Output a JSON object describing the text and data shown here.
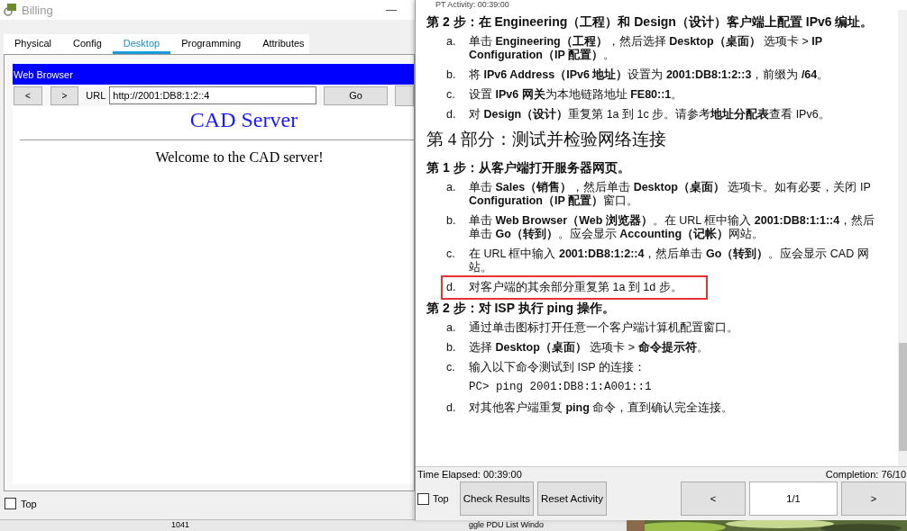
{
  "left_window": {
    "title": "Billing",
    "tabs": [
      {
        "label": "Physical",
        "selected": false
      },
      {
        "label": "Config",
        "selected": false
      },
      {
        "label": "Desktop",
        "selected": true
      },
      {
        "label": "Programming",
        "selected": false
      },
      {
        "label": "Attributes",
        "selected": false
      }
    ],
    "browser": {
      "title": "Web Browser",
      "back": "<",
      "forward": ">",
      "url_label": "URL",
      "url": "http://2001:DB8:1:2::4",
      "go": "Go",
      "page_heading": "CAD Server",
      "page_text": "Welcome to the CAD server!"
    },
    "top": {
      "label": "Top",
      "checked": false
    }
  },
  "activity_window": {
    "title": "PT Activity: 00:39:00",
    "blocks": [
      {
        "kind": "step",
        "text": "第 2 步：在 Engineering（工程）和 Design（设计）客户端上配置 IPv6 编址。"
      },
      {
        "kind": "item",
        "letter": "a.",
        "text": "单击 **Engineering（工程）**，然后选择 **Desktop（桌面）** 选项卡 > **IP Configuration（IP 配置）**。",
        "highlighted": false
      },
      {
        "kind": "item",
        "letter": "b.",
        "text": "将 **IPv6 Address（IPv6 地址）**设置为 **2001:DB8:1:2::3**，前缀为 **/64**。",
        "highlighted": false
      },
      {
        "kind": "item",
        "letter": "c.",
        "text": "设置 **IPv6 网关**为本地链路地址 **FE80::1**。",
        "highlighted": false
      },
      {
        "kind": "item",
        "letter": "d.",
        "text": "对 **Design（设计）**重复第 1a 到 1c 步。请参考**地址分配表**查看 IPv6。",
        "highlighted": false
      },
      {
        "kind": "part",
        "text": "第 4 部分：测试并检验网络连接"
      },
      {
        "kind": "step",
        "text": "第 1 步：从客户端打开服务器网页。"
      },
      {
        "kind": "item",
        "letter": "a.",
        "text": "单击 **Sales（销售）**，然后单击 **Desktop（桌面）** 选项卡。如有必要，关闭 IP **Configuration（IP 配置）**窗口。",
        "highlighted": false
      },
      {
        "kind": "item",
        "letter": "b.",
        "text": "单击 **Web Browser（Web 浏览器）**。在 URL 框中输入 **2001:DB8:1:1::4**，然后单击 **Go（转到）**。应会显示 **Accounting（记帐）**网站。",
        "highlighted": false
      },
      {
        "kind": "item",
        "letter": "c.",
        "text": "在 URL 框中输入 **2001:DB8:1:2::4**，然后单击 **Go（转到）**。应会显示 CAD 网站。",
        "highlighted": false
      },
      {
        "kind": "item",
        "letter": "d.",
        "text": "对客户端的其余部分重复第 1a 到 1d 步。",
        "highlighted": true
      },
      {
        "kind": "step",
        "text": "第 2 步：对 ISP 执行 ping 操作。"
      },
      {
        "kind": "item",
        "letter": "a.",
        "text": "通过单击图标打开任意一个客户端计算机配置窗口。",
        "highlighted": false
      },
      {
        "kind": "item",
        "letter": "b.",
        "text": "选择 **Desktop（桌面）** 选项卡 > **命令提示符**。",
        "highlighted": false
      },
      {
        "kind": "item",
        "letter": "c.",
        "text": "输入以下命令测试到 ISP 的连接：",
        "highlighted": false
      },
      {
        "kind": "code",
        "text": "PC> ping 2001:DB8:1:A001::1"
      },
      {
        "kind": "item",
        "letter": "d.",
        "text": "对其他客户端重复 **ping** 命令，直到确认完全连接。",
        "highlighted": false
      }
    ],
    "time_elapsed": "Time Elapsed: 00:39:00",
    "completion": "Completion: 76/10",
    "top": {
      "label": "Top",
      "checked": false
    },
    "check_results": "Check Results",
    "reset_activity": "Reset Activity",
    "prev": "<",
    "page": "1/1",
    "next": ">"
  },
  "background": {
    "texts": [
      "1041",
      "ggle PDU List Windo"
    ]
  }
}
